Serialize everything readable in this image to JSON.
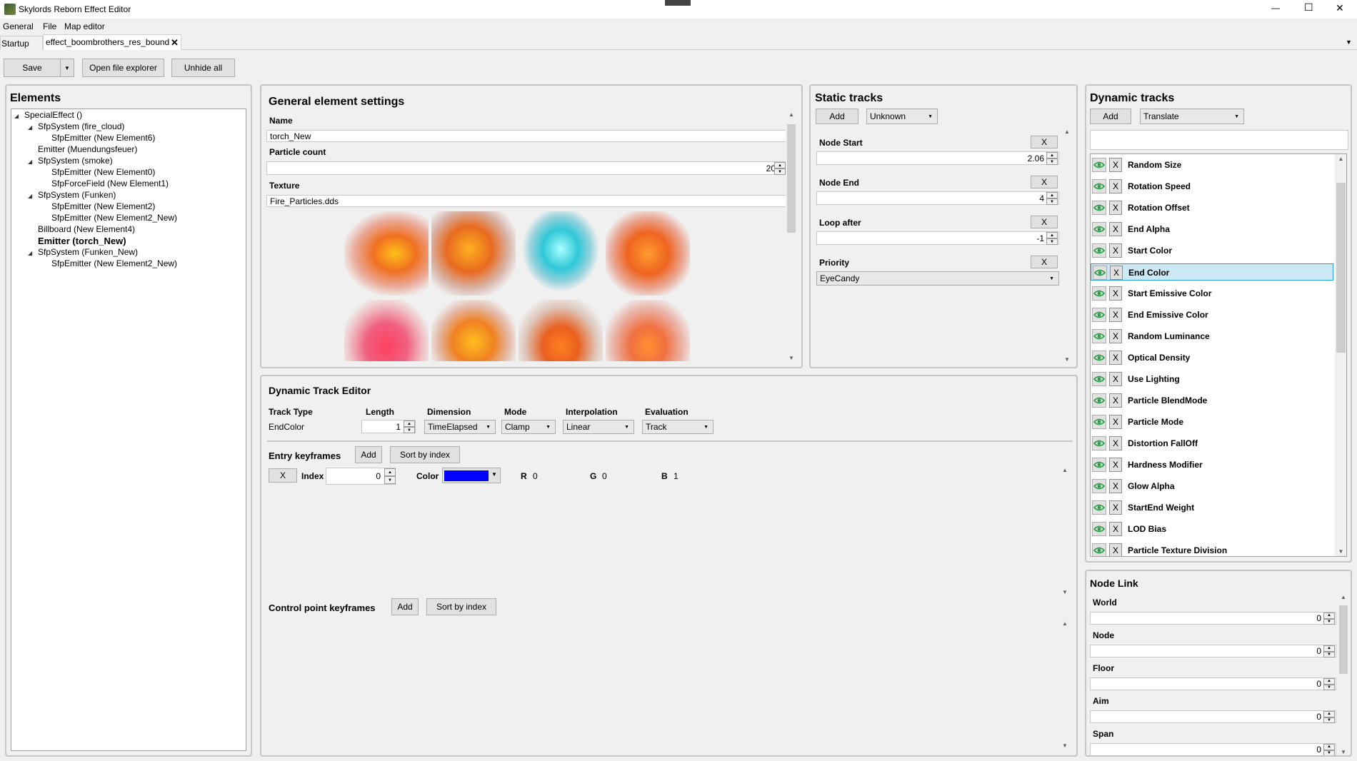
{
  "window": {
    "title": "Skylords Reborn Effect Editor",
    "minimize": "—",
    "maximize": "☐",
    "close": "✕"
  },
  "menu": [
    "General",
    "File",
    "Map editor"
  ],
  "tabs": [
    {
      "label": "Startup"
    },
    {
      "label": "effect_boombrothers_res_bound",
      "close": "✕"
    }
  ],
  "toolbar": {
    "save": "Save",
    "open_explorer": "Open file explorer",
    "unhide_all": "Unhide all"
  },
  "elements": {
    "title": "Elements",
    "tree": [
      {
        "label": "SpecialEffect ()",
        "level": 0,
        "expander": true,
        "bold": false
      },
      {
        "label": "SfpSystem (fire_cloud)",
        "level": 1,
        "expander": true,
        "bold": false
      },
      {
        "label": "SfpEmitter (New Element6)",
        "level": 2,
        "expander": false,
        "bold": false
      },
      {
        "label": "Emitter (Muendungsfeuer)",
        "level": 1,
        "expander": false,
        "bold": false
      },
      {
        "label": "SfpSystem (smoke)",
        "level": 1,
        "expander": true,
        "bold": false
      },
      {
        "label": "SfpEmitter (New Element0)",
        "level": 2,
        "expander": false,
        "bold": false
      },
      {
        "label": "SfpForceField (New Element1)",
        "level": 2,
        "expander": false,
        "bold": false
      },
      {
        "label": "SfpSystem (Funken)",
        "level": 1,
        "expander": true,
        "bold": false
      },
      {
        "label": "SfpEmitter (New Element2)",
        "level": 2,
        "expander": false,
        "bold": false
      },
      {
        "label": "SfpEmitter (New Element2_New)",
        "level": 2,
        "expander": false,
        "bold": false
      },
      {
        "label": "Billboard (New Element4)",
        "level": 1,
        "expander": false,
        "bold": false
      },
      {
        "label": "Emitter (torch_New)",
        "level": 1,
        "expander": false,
        "bold": true
      },
      {
        "label": "SfpSystem (Funken_New)",
        "level": 1,
        "expander": true,
        "bold": false
      },
      {
        "label": "SfpEmitter (New Element2_New)",
        "level": 2,
        "expander": false,
        "bold": false
      }
    ]
  },
  "general": {
    "title": "General element settings",
    "name_label": "Name",
    "name_value": "torch_New",
    "particle_label": "Particle count",
    "particle_value": "20",
    "texture_label": "Texture",
    "texture_value": "Fire_Particles.dds"
  },
  "static": {
    "title": "Static tracks",
    "add": "Add",
    "type": "Unknown",
    "tracks": [
      {
        "label": "Node Start",
        "value": "2.06",
        "x": "X"
      },
      {
        "label": "Node End",
        "value": "4",
        "x": "X"
      },
      {
        "label": "Loop after",
        "value": "-1",
        "x": "X"
      }
    ],
    "priority_label": "Priority",
    "priority_x": "X",
    "priority_value": "EyeCandy"
  },
  "dynamic": {
    "title": "Dynamic tracks",
    "add": "Add",
    "type": "Translate",
    "x": "X",
    "items": [
      {
        "name": "Random Size",
        "selected": false
      },
      {
        "name": "Rotation Speed",
        "selected": false
      },
      {
        "name": "Rotation Offset",
        "selected": false
      },
      {
        "name": "End Alpha",
        "selected": false
      },
      {
        "name": "Start Color",
        "selected": false
      },
      {
        "name": "End Color",
        "selected": true
      },
      {
        "name": "Start Emissive Color",
        "selected": false
      },
      {
        "name": "End Emissive Color",
        "selected": false
      },
      {
        "name": "Random Luminance",
        "selected": false
      },
      {
        "name": "Optical Density",
        "selected": false
      },
      {
        "name": "Use Lighting",
        "selected": false
      },
      {
        "name": "Particle BlendMode",
        "selected": false
      },
      {
        "name": "Particle Mode",
        "selected": false
      },
      {
        "name": "Distortion FallOff",
        "selected": false
      },
      {
        "name": "Hardness Modifier",
        "selected": false
      },
      {
        "name": "Glow Alpha",
        "selected": false
      },
      {
        "name": "StartEnd Weight",
        "selected": false
      },
      {
        "name": "LOD Bias",
        "selected": false
      },
      {
        "name": "Particle Texture Division",
        "selected": false
      }
    ]
  },
  "editor": {
    "title": "Dynamic Track Editor",
    "track_type_label": "Track Type",
    "track_type_value": "EndColor",
    "length_label": "Length",
    "length_value": "1",
    "dimension_label": "Dimension",
    "dimension_value": "TimeElapsed",
    "mode_label": "Mode",
    "mode_value": "Clamp",
    "interp_label": "Interpolation",
    "interp_value": "Linear",
    "eval_label": "Evaluation",
    "eval_value": "Track",
    "entry_label": "Entry keyframes",
    "entry_add": "Add",
    "entry_sort": "Sort by index",
    "kf": {
      "x": "X",
      "index_label": "Index",
      "index_value": "0",
      "color_label": "Color",
      "color": "#0000ff",
      "r_label": "R",
      "r": "0",
      "g_label": "G",
      "g": "0",
      "b_label": "B",
      "b": "1"
    },
    "control_label": "Control point keyframes",
    "control_add": "Add",
    "control_sort": "Sort by index"
  },
  "node_link": {
    "title": "Node Link",
    "fields": [
      {
        "label": "World",
        "value": "0"
      },
      {
        "label": "Node",
        "value": "0"
      },
      {
        "label": "Floor",
        "value": "0"
      },
      {
        "label": "Aim",
        "value": "0"
      },
      {
        "label": "Span",
        "value": "0"
      }
    ]
  },
  "colors": {
    "accent": "#26a0da",
    "selection": "#cce8f4",
    "eye": "#2e9e4a",
    "keyframe_color": "#0000ff"
  }
}
